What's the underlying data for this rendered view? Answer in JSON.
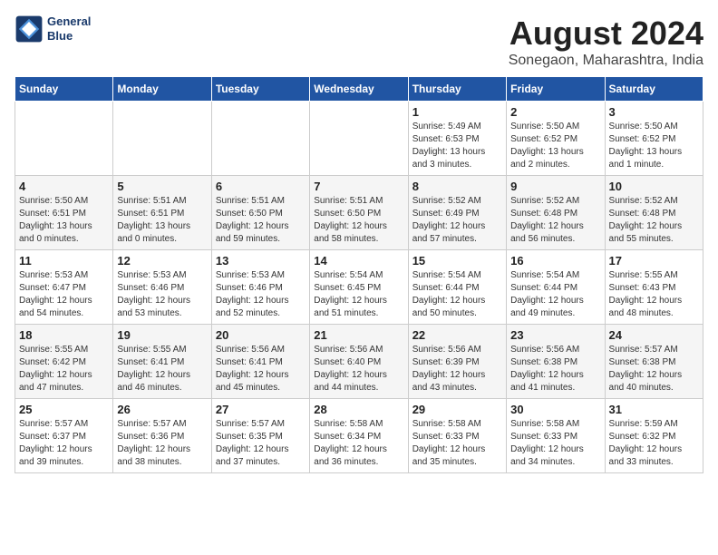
{
  "header": {
    "logo_line1": "General",
    "logo_line2": "Blue",
    "title": "August 2024",
    "subtitle": "Sonegaon, Maharashtra, India"
  },
  "weekdays": [
    "Sunday",
    "Monday",
    "Tuesday",
    "Wednesday",
    "Thursday",
    "Friday",
    "Saturday"
  ],
  "weeks": [
    [
      {
        "day": "",
        "detail": ""
      },
      {
        "day": "",
        "detail": ""
      },
      {
        "day": "",
        "detail": ""
      },
      {
        "day": "",
        "detail": ""
      },
      {
        "day": "1",
        "detail": "Sunrise: 5:49 AM\nSunset: 6:53 PM\nDaylight: 13 hours\nand 3 minutes."
      },
      {
        "day": "2",
        "detail": "Sunrise: 5:50 AM\nSunset: 6:52 PM\nDaylight: 13 hours\nand 2 minutes."
      },
      {
        "day": "3",
        "detail": "Sunrise: 5:50 AM\nSunset: 6:52 PM\nDaylight: 13 hours\nand 1 minute."
      }
    ],
    [
      {
        "day": "4",
        "detail": "Sunrise: 5:50 AM\nSunset: 6:51 PM\nDaylight: 13 hours\nand 0 minutes."
      },
      {
        "day": "5",
        "detail": "Sunrise: 5:51 AM\nSunset: 6:51 PM\nDaylight: 13 hours\nand 0 minutes."
      },
      {
        "day": "6",
        "detail": "Sunrise: 5:51 AM\nSunset: 6:50 PM\nDaylight: 12 hours\nand 59 minutes."
      },
      {
        "day": "7",
        "detail": "Sunrise: 5:51 AM\nSunset: 6:50 PM\nDaylight: 12 hours\nand 58 minutes."
      },
      {
        "day": "8",
        "detail": "Sunrise: 5:52 AM\nSunset: 6:49 PM\nDaylight: 12 hours\nand 57 minutes."
      },
      {
        "day": "9",
        "detail": "Sunrise: 5:52 AM\nSunset: 6:48 PM\nDaylight: 12 hours\nand 56 minutes."
      },
      {
        "day": "10",
        "detail": "Sunrise: 5:52 AM\nSunset: 6:48 PM\nDaylight: 12 hours\nand 55 minutes."
      }
    ],
    [
      {
        "day": "11",
        "detail": "Sunrise: 5:53 AM\nSunset: 6:47 PM\nDaylight: 12 hours\nand 54 minutes."
      },
      {
        "day": "12",
        "detail": "Sunrise: 5:53 AM\nSunset: 6:46 PM\nDaylight: 12 hours\nand 53 minutes."
      },
      {
        "day": "13",
        "detail": "Sunrise: 5:53 AM\nSunset: 6:46 PM\nDaylight: 12 hours\nand 52 minutes."
      },
      {
        "day": "14",
        "detail": "Sunrise: 5:54 AM\nSunset: 6:45 PM\nDaylight: 12 hours\nand 51 minutes."
      },
      {
        "day": "15",
        "detail": "Sunrise: 5:54 AM\nSunset: 6:44 PM\nDaylight: 12 hours\nand 50 minutes."
      },
      {
        "day": "16",
        "detail": "Sunrise: 5:54 AM\nSunset: 6:44 PM\nDaylight: 12 hours\nand 49 minutes."
      },
      {
        "day": "17",
        "detail": "Sunrise: 5:55 AM\nSunset: 6:43 PM\nDaylight: 12 hours\nand 48 minutes."
      }
    ],
    [
      {
        "day": "18",
        "detail": "Sunrise: 5:55 AM\nSunset: 6:42 PM\nDaylight: 12 hours\nand 47 minutes."
      },
      {
        "day": "19",
        "detail": "Sunrise: 5:55 AM\nSunset: 6:41 PM\nDaylight: 12 hours\nand 46 minutes."
      },
      {
        "day": "20",
        "detail": "Sunrise: 5:56 AM\nSunset: 6:41 PM\nDaylight: 12 hours\nand 45 minutes."
      },
      {
        "day": "21",
        "detail": "Sunrise: 5:56 AM\nSunset: 6:40 PM\nDaylight: 12 hours\nand 44 minutes."
      },
      {
        "day": "22",
        "detail": "Sunrise: 5:56 AM\nSunset: 6:39 PM\nDaylight: 12 hours\nand 43 minutes."
      },
      {
        "day": "23",
        "detail": "Sunrise: 5:56 AM\nSunset: 6:38 PM\nDaylight: 12 hours\nand 41 minutes."
      },
      {
        "day": "24",
        "detail": "Sunrise: 5:57 AM\nSunset: 6:38 PM\nDaylight: 12 hours\nand 40 minutes."
      }
    ],
    [
      {
        "day": "25",
        "detail": "Sunrise: 5:57 AM\nSunset: 6:37 PM\nDaylight: 12 hours\nand 39 minutes."
      },
      {
        "day": "26",
        "detail": "Sunrise: 5:57 AM\nSunset: 6:36 PM\nDaylight: 12 hours\nand 38 minutes."
      },
      {
        "day": "27",
        "detail": "Sunrise: 5:57 AM\nSunset: 6:35 PM\nDaylight: 12 hours\nand 37 minutes."
      },
      {
        "day": "28",
        "detail": "Sunrise: 5:58 AM\nSunset: 6:34 PM\nDaylight: 12 hours\nand 36 minutes."
      },
      {
        "day": "29",
        "detail": "Sunrise: 5:58 AM\nSunset: 6:33 PM\nDaylight: 12 hours\nand 35 minutes."
      },
      {
        "day": "30",
        "detail": "Sunrise: 5:58 AM\nSunset: 6:33 PM\nDaylight: 12 hours\nand 34 minutes."
      },
      {
        "day": "31",
        "detail": "Sunrise: 5:59 AM\nSunset: 6:32 PM\nDaylight: 12 hours\nand 33 minutes."
      }
    ]
  ]
}
